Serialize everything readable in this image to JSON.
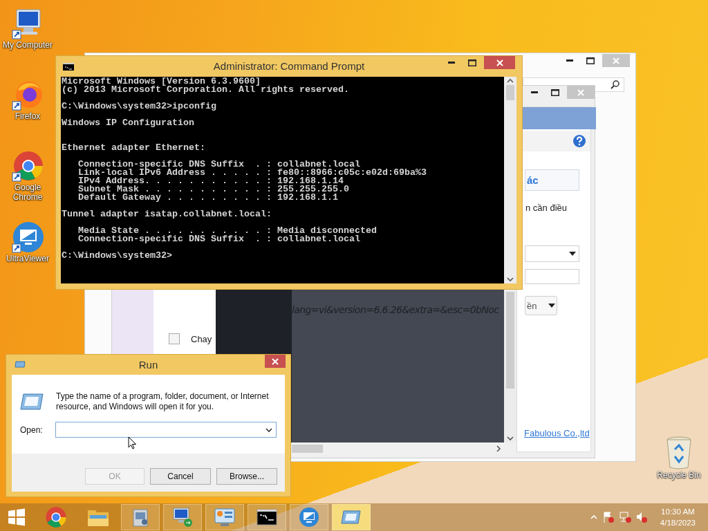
{
  "desktop_icons": [
    {
      "label": "My Computer",
      "kind": "computer"
    },
    {
      "label": "Firefox",
      "kind": "firefox"
    },
    {
      "label": "Google Chrome",
      "kind": "chrome"
    },
    {
      "label": "UltraViewer",
      "kind": "ultraviewer"
    }
  ],
  "recycle_bin": {
    "label": "Recycle Bin"
  },
  "background_window": {
    "action_button": "ác",
    "description": "n cần điều",
    "select_value": "ền",
    "checkbox": {
      "label": "Chay",
      "checked": false
    },
    "address_text": "lang=vi&version=6.6.26&extra=&esc=0bNoc",
    "link": "Fabulous Co.,ltd"
  },
  "command_prompt": {
    "title": "Administrator:  Command Prompt",
    "output": "Microsoft Windows [Version 6.3.9600]\n(c) 2013 Microsoft Corporation. All rights reserved.\n\nC:\\Windows\\system32>ipconfig\n\nWindows IP Configuration\n\n\nEthernet adapter Ethernet:\n\n   Connection-specific DNS Suffix  . : collabnet.local\n   Link-local IPv6 Address . . . . . : fe80::8966:c05c:e02d:69ba%3\n   IPv4 Address. . . . . . . . . . . : 192.168.1.14\n   Subnet Mask . . . . . . . . . . . : 255.255.255.0\n   Default Gateway . . . . . . . . . : 192.168.1.1\n\nTunnel adapter isatap.collabnet.local:\n\n   Media State . . . . . . . . . . . : Media disconnected\n   Connection-specific DNS Suffix  . : collabnet.local\n\nC:\\Windows\\system32>"
  },
  "run_dialog": {
    "title": "Run",
    "description": "Type the name of a program, folder, document, or Internet resource, and Windows will open it for you.",
    "open_label": "Open:",
    "buttons": [
      {
        "label": "OK",
        "disabled": true
      },
      {
        "label": "Cancel",
        "disabled": false
      },
      {
        "label": "Browse...",
        "disabled": false
      }
    ]
  },
  "taskbar": {
    "items": [
      {
        "kind": "start",
        "running": false,
        "active": false
      },
      {
        "kind": "chrome",
        "running": false,
        "active": false
      },
      {
        "kind": "folder",
        "running": false,
        "active": false
      },
      {
        "kind": "installer",
        "running": true,
        "active": false
      },
      {
        "kind": "remote",
        "running": true,
        "active": false
      },
      {
        "kind": "control",
        "running": true,
        "active": false
      },
      {
        "kind": "console",
        "running": true,
        "active": false
      },
      {
        "kind": "ultraviewer",
        "running": true,
        "active": false
      },
      {
        "kind": "run",
        "running": true,
        "active": true
      }
    ],
    "clock": {
      "time": "10:30 AM",
      "date": "4/18/2023"
    }
  }
}
